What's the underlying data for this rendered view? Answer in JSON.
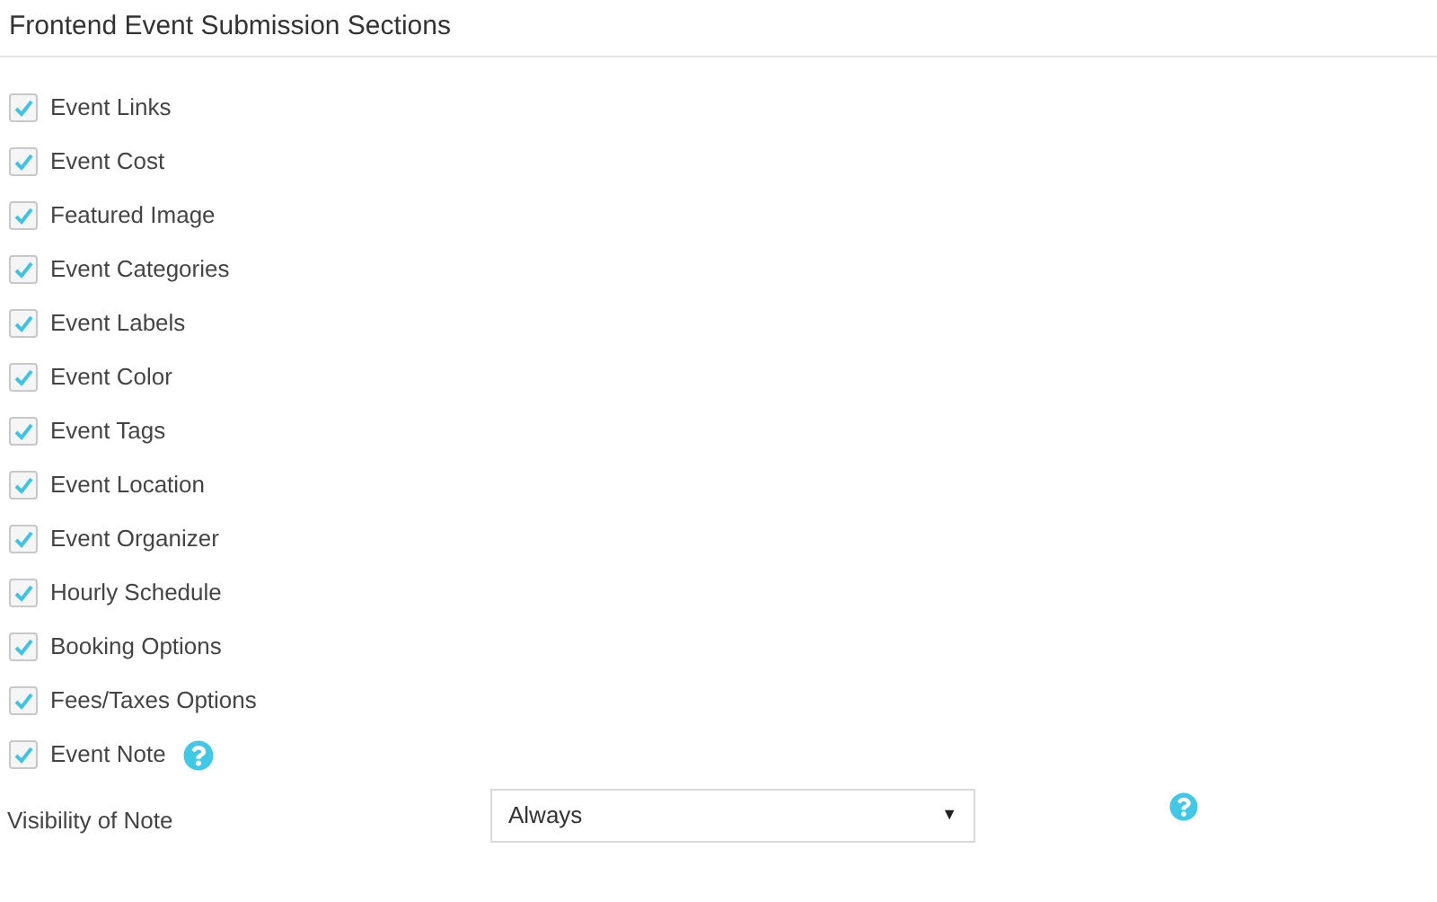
{
  "section": {
    "title": "Frontend Event Submission Sections"
  },
  "options": [
    {
      "label": "Event Links",
      "checked": true
    },
    {
      "label": "Event Cost",
      "checked": true
    },
    {
      "label": "Featured Image",
      "checked": true
    },
    {
      "label": "Event Categories",
      "checked": true
    },
    {
      "label": "Event Labels",
      "checked": true
    },
    {
      "label": "Event Color",
      "checked": true
    },
    {
      "label": "Event Tags",
      "checked": true
    },
    {
      "label": "Event Location",
      "checked": true
    },
    {
      "label": "Event Organizer",
      "checked": true
    },
    {
      "label": "Hourly Schedule",
      "checked": true
    },
    {
      "label": "Booking Options",
      "checked": true
    },
    {
      "label": "Fees/Taxes Options",
      "checked": true
    },
    {
      "label": "Event Note",
      "checked": true,
      "help": true
    }
  ],
  "visibility": {
    "label": "Visibility of Note",
    "value": "Always",
    "arrow": "▼"
  }
}
